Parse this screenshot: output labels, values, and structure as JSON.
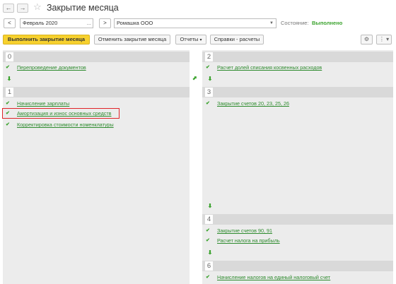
{
  "window": {
    "title": "Закрытие месяца"
  },
  "params": {
    "period": "Февраль 2020",
    "organization": "Ромашка ООО",
    "state_label": "Состояние:",
    "state_value": "Выполнено"
  },
  "toolbar": {
    "run": "Выполнить закрытие месяца",
    "cancel": "Отменить закрытие месяца",
    "reports": "Отчеты",
    "references": "Справки - расчеты"
  },
  "steps": [
    {
      "num": "0",
      "tasks": [
        "Перепроведение документов"
      ]
    },
    {
      "num": "1",
      "tasks": [
        "Начисление зарплаты",
        "Амортизация и износ основных средств",
        "Корректировка стоимости номенклатуры"
      ]
    },
    {
      "num": "2",
      "tasks": [
        "Расчет долей списания косвенных расходов"
      ]
    },
    {
      "num": "3",
      "tasks": [
        "Закрытие счетов 20, 23, 25, 26"
      ]
    },
    {
      "num": "4",
      "tasks": [
        "Закрытие счетов 90, 91",
        "Расчет налога на прибыль"
      ]
    },
    {
      "num": "6",
      "tasks": [
        "Начисление налогов на единый налоговый счет"
      ]
    }
  ]
}
